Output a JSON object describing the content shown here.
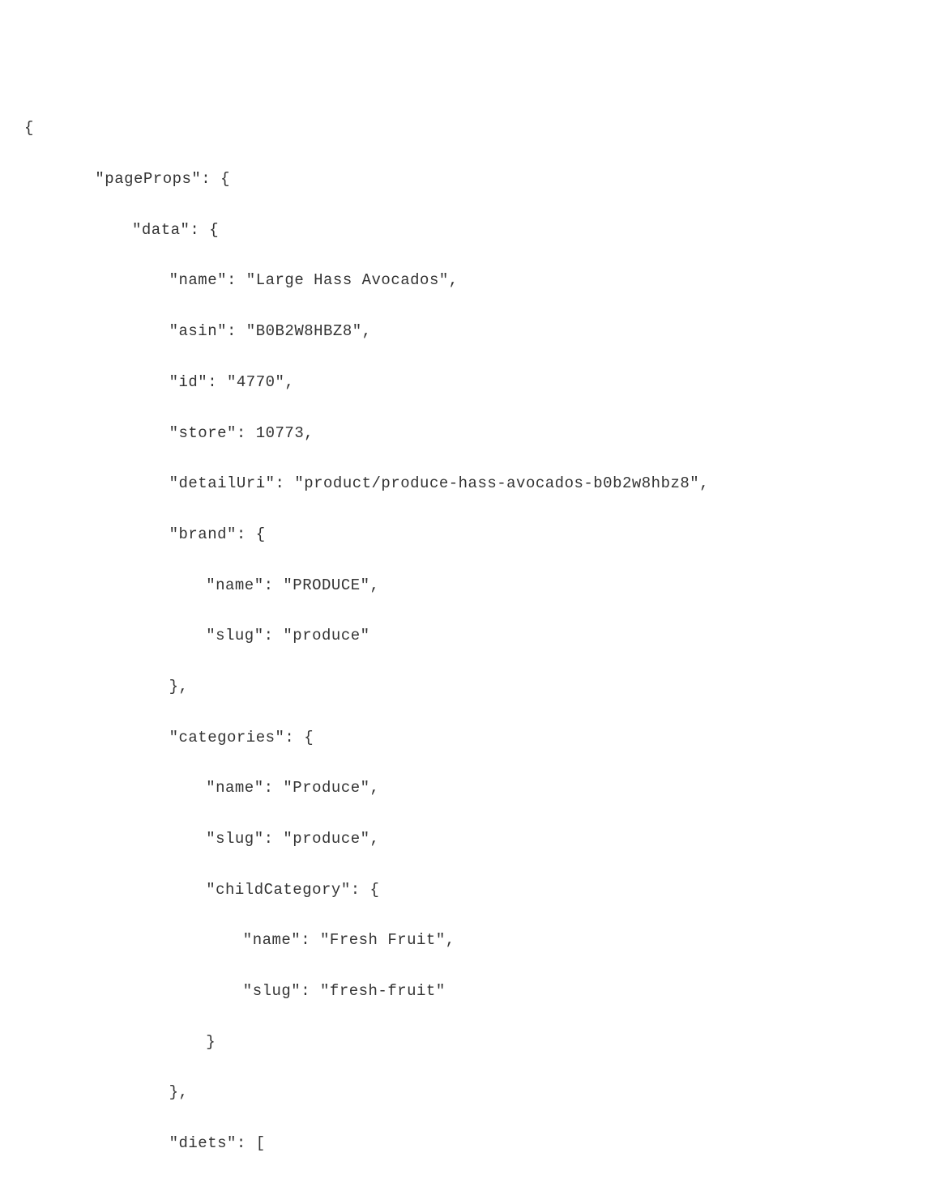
{
  "lines": {
    "l0": "{",
    "l1": "\"pageProps\": {",
    "l2": "\"data\": {",
    "l3": "\"name\": \"Large Hass Avocados\",",
    "l4": "\"asin\": \"B0B2W8HBZ8\",",
    "l5": "\"id\": \"4770\",",
    "l6": "\"store\": 10773,",
    "l7": "\"detailUri\": \"product/produce-hass-avocados-b0b2w8hbz8\",",
    "l8": "\"brand\": {",
    "l9": "\"name\": \"PRODUCE\",",
    "l10": "\"slug\": \"produce\"",
    "l11": "},",
    "l12": "\"categories\": {",
    "l13": "\"name\": \"Produce\",",
    "l14": "\"slug\": \"produce\",",
    "l15": "\"childCategory\": {",
    "l16": "\"name\": \"Fresh Fruit\",",
    "l17": "\"slug\": \"fresh-fruit\"",
    "l18": "}",
    "l19": "},",
    "l20": "\"diets\": ["
  }
}
